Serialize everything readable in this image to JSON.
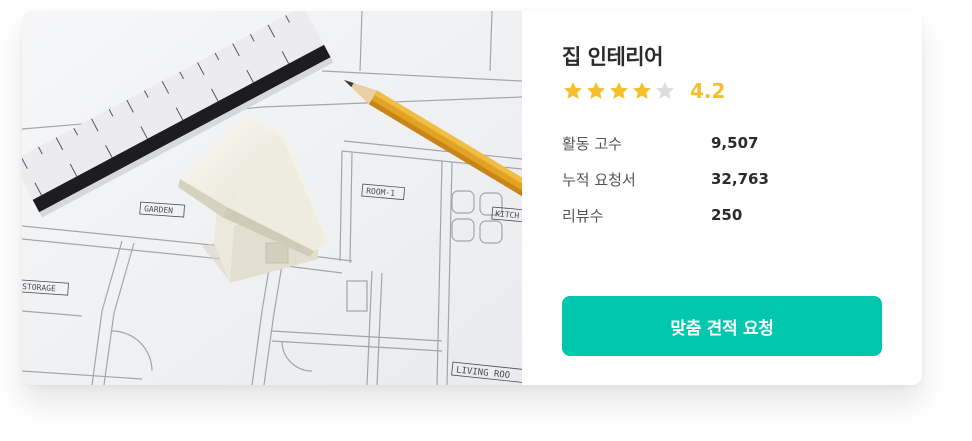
{
  "card": {
    "title": "집 인테리어",
    "rating": {
      "value": "4.2",
      "stars_filled": 4,
      "stars_total": 5
    },
    "stats": [
      {
        "label": "활동 고수",
        "value": "9,507"
      },
      {
        "label": "누적 요청서",
        "value": "32,763"
      },
      {
        "label": "리뷰수",
        "value": "250"
      }
    ],
    "cta_label": "맞춤 견적 요청"
  },
  "photo": {
    "plan_labels": [
      "GARDEN",
      "ROOM-1",
      "KITCH",
      "STORAGE",
      "LIVING ROO"
    ]
  },
  "colors": {
    "accent": "#00c7ae",
    "star": "#f5bf2a",
    "star_empty": "#dcdcdc",
    "title": "#2b2b2b"
  }
}
